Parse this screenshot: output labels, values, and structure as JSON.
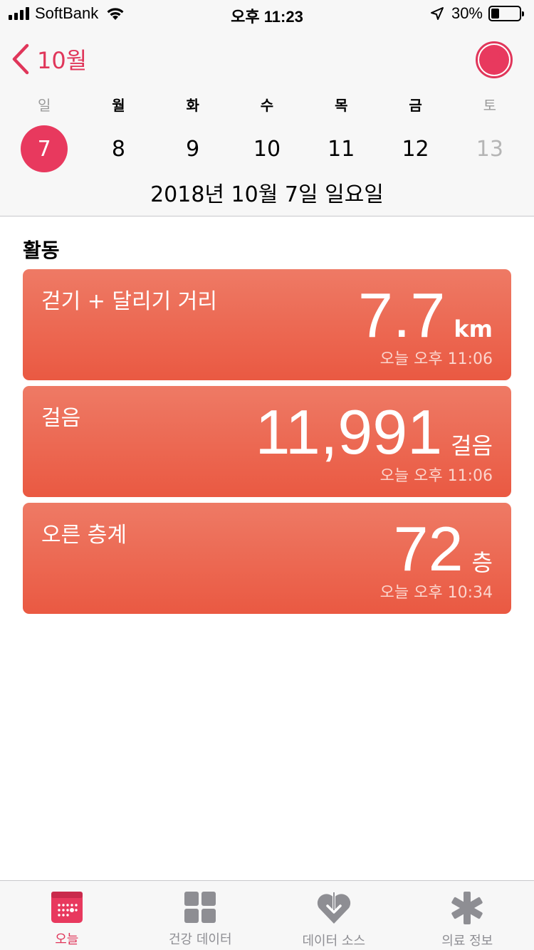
{
  "status_bar": {
    "carrier": "SoftBank",
    "time": "오후 11:23",
    "battery": "30%",
    "battery_level": 0.3
  },
  "header": {
    "back_label": "10월",
    "weekdays": [
      "일",
      "월",
      "화",
      "수",
      "목",
      "금",
      "토"
    ],
    "dates": [
      "7",
      "8",
      "9",
      "10",
      "11",
      "12",
      "13"
    ],
    "selected_index": 0,
    "full_date": "2018년 10월 7일 일요일"
  },
  "section": {
    "title": "활동"
  },
  "cards": [
    {
      "title": "걷기 + 달리기 거리",
      "value": "7.7",
      "unit": "km",
      "time": "오늘 오후 11:06"
    },
    {
      "title": "걸음",
      "value": "11,991",
      "unit": "걸음",
      "time": "오늘 오후 11:06"
    },
    {
      "title": "오른 층계",
      "value": "72",
      "unit": "층",
      "time": "오늘 오후 10:34"
    }
  ],
  "tabbar": {
    "items": [
      {
        "label": "오늘",
        "icon": "today-calendar-icon",
        "active": true
      },
      {
        "label": "건강 데이터",
        "icon": "grid-icon",
        "active": false
      },
      {
        "label": "데이터 소스",
        "icon": "heart-download-icon",
        "active": false
      },
      {
        "label": "의료 정보",
        "icon": "medical-asterisk-icon",
        "active": false
      }
    ]
  },
  "colors": {
    "accent": "#e0365a",
    "card_top": "#ee7a65",
    "card_bottom": "#ea5942",
    "inactive": "#8e8e93"
  }
}
